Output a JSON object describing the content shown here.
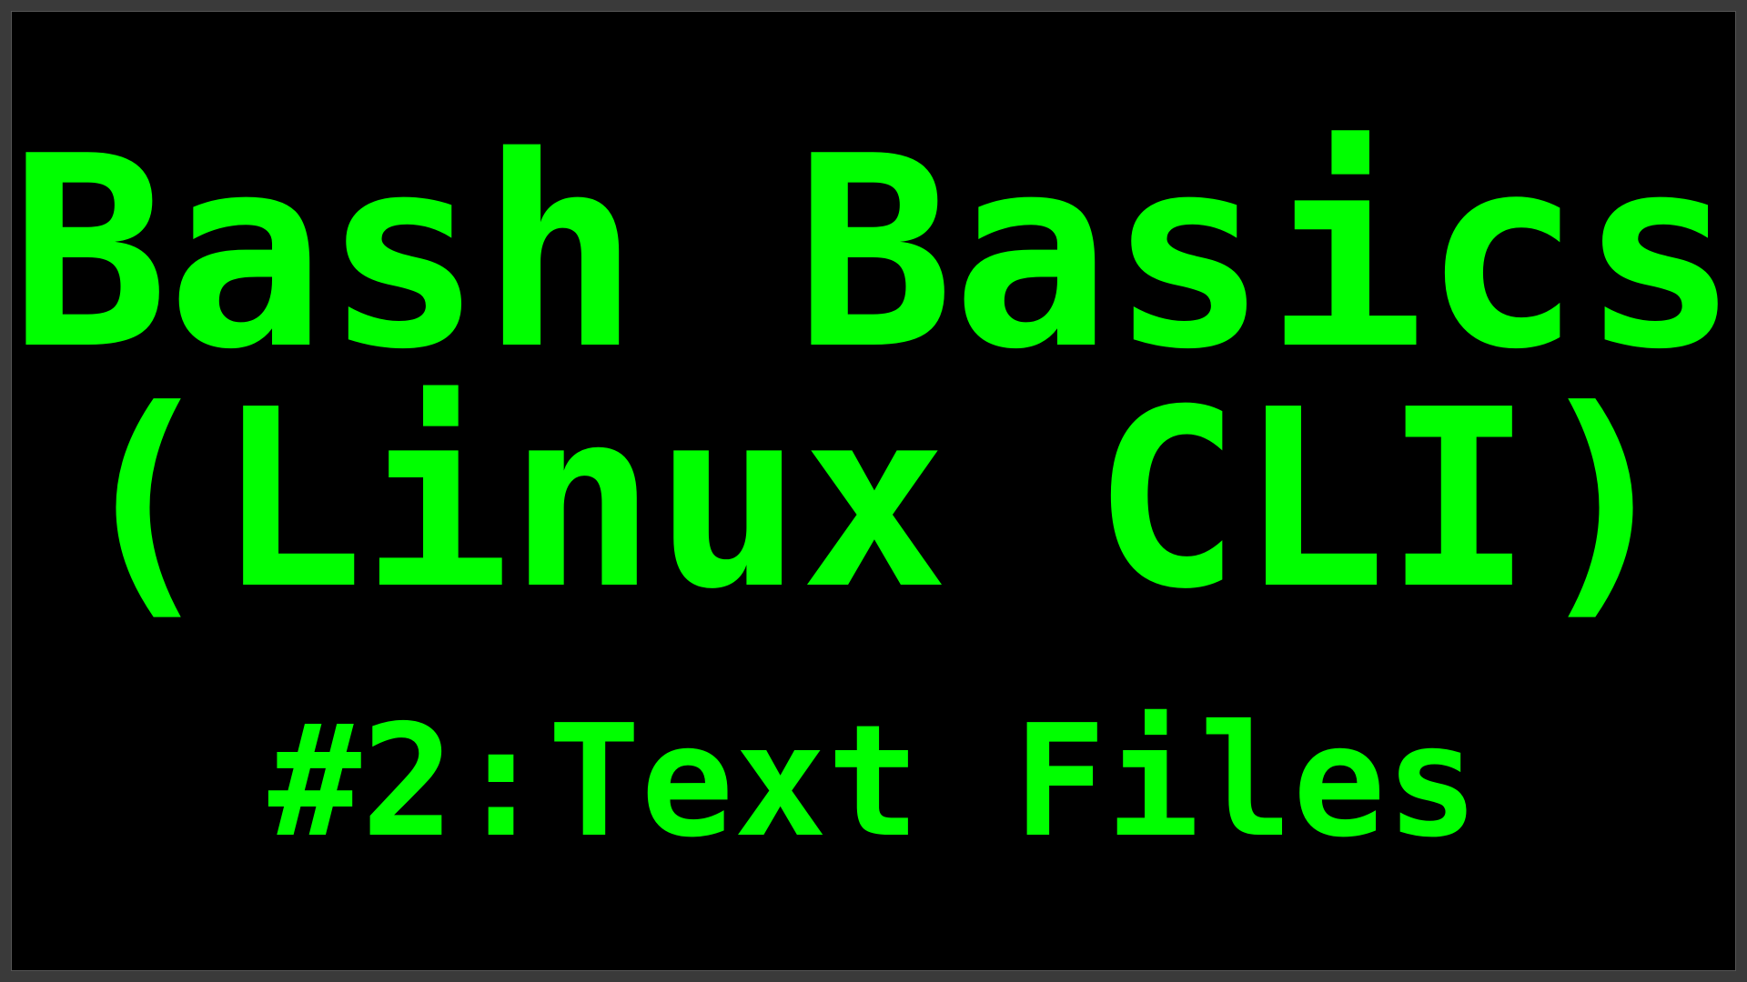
{
  "slide": {
    "title": "Bash Basics",
    "subtitle": "(Linux CLI)",
    "episode": "#2:Text Files"
  },
  "colors": {
    "background": "#000000",
    "text": "#00ff00"
  }
}
